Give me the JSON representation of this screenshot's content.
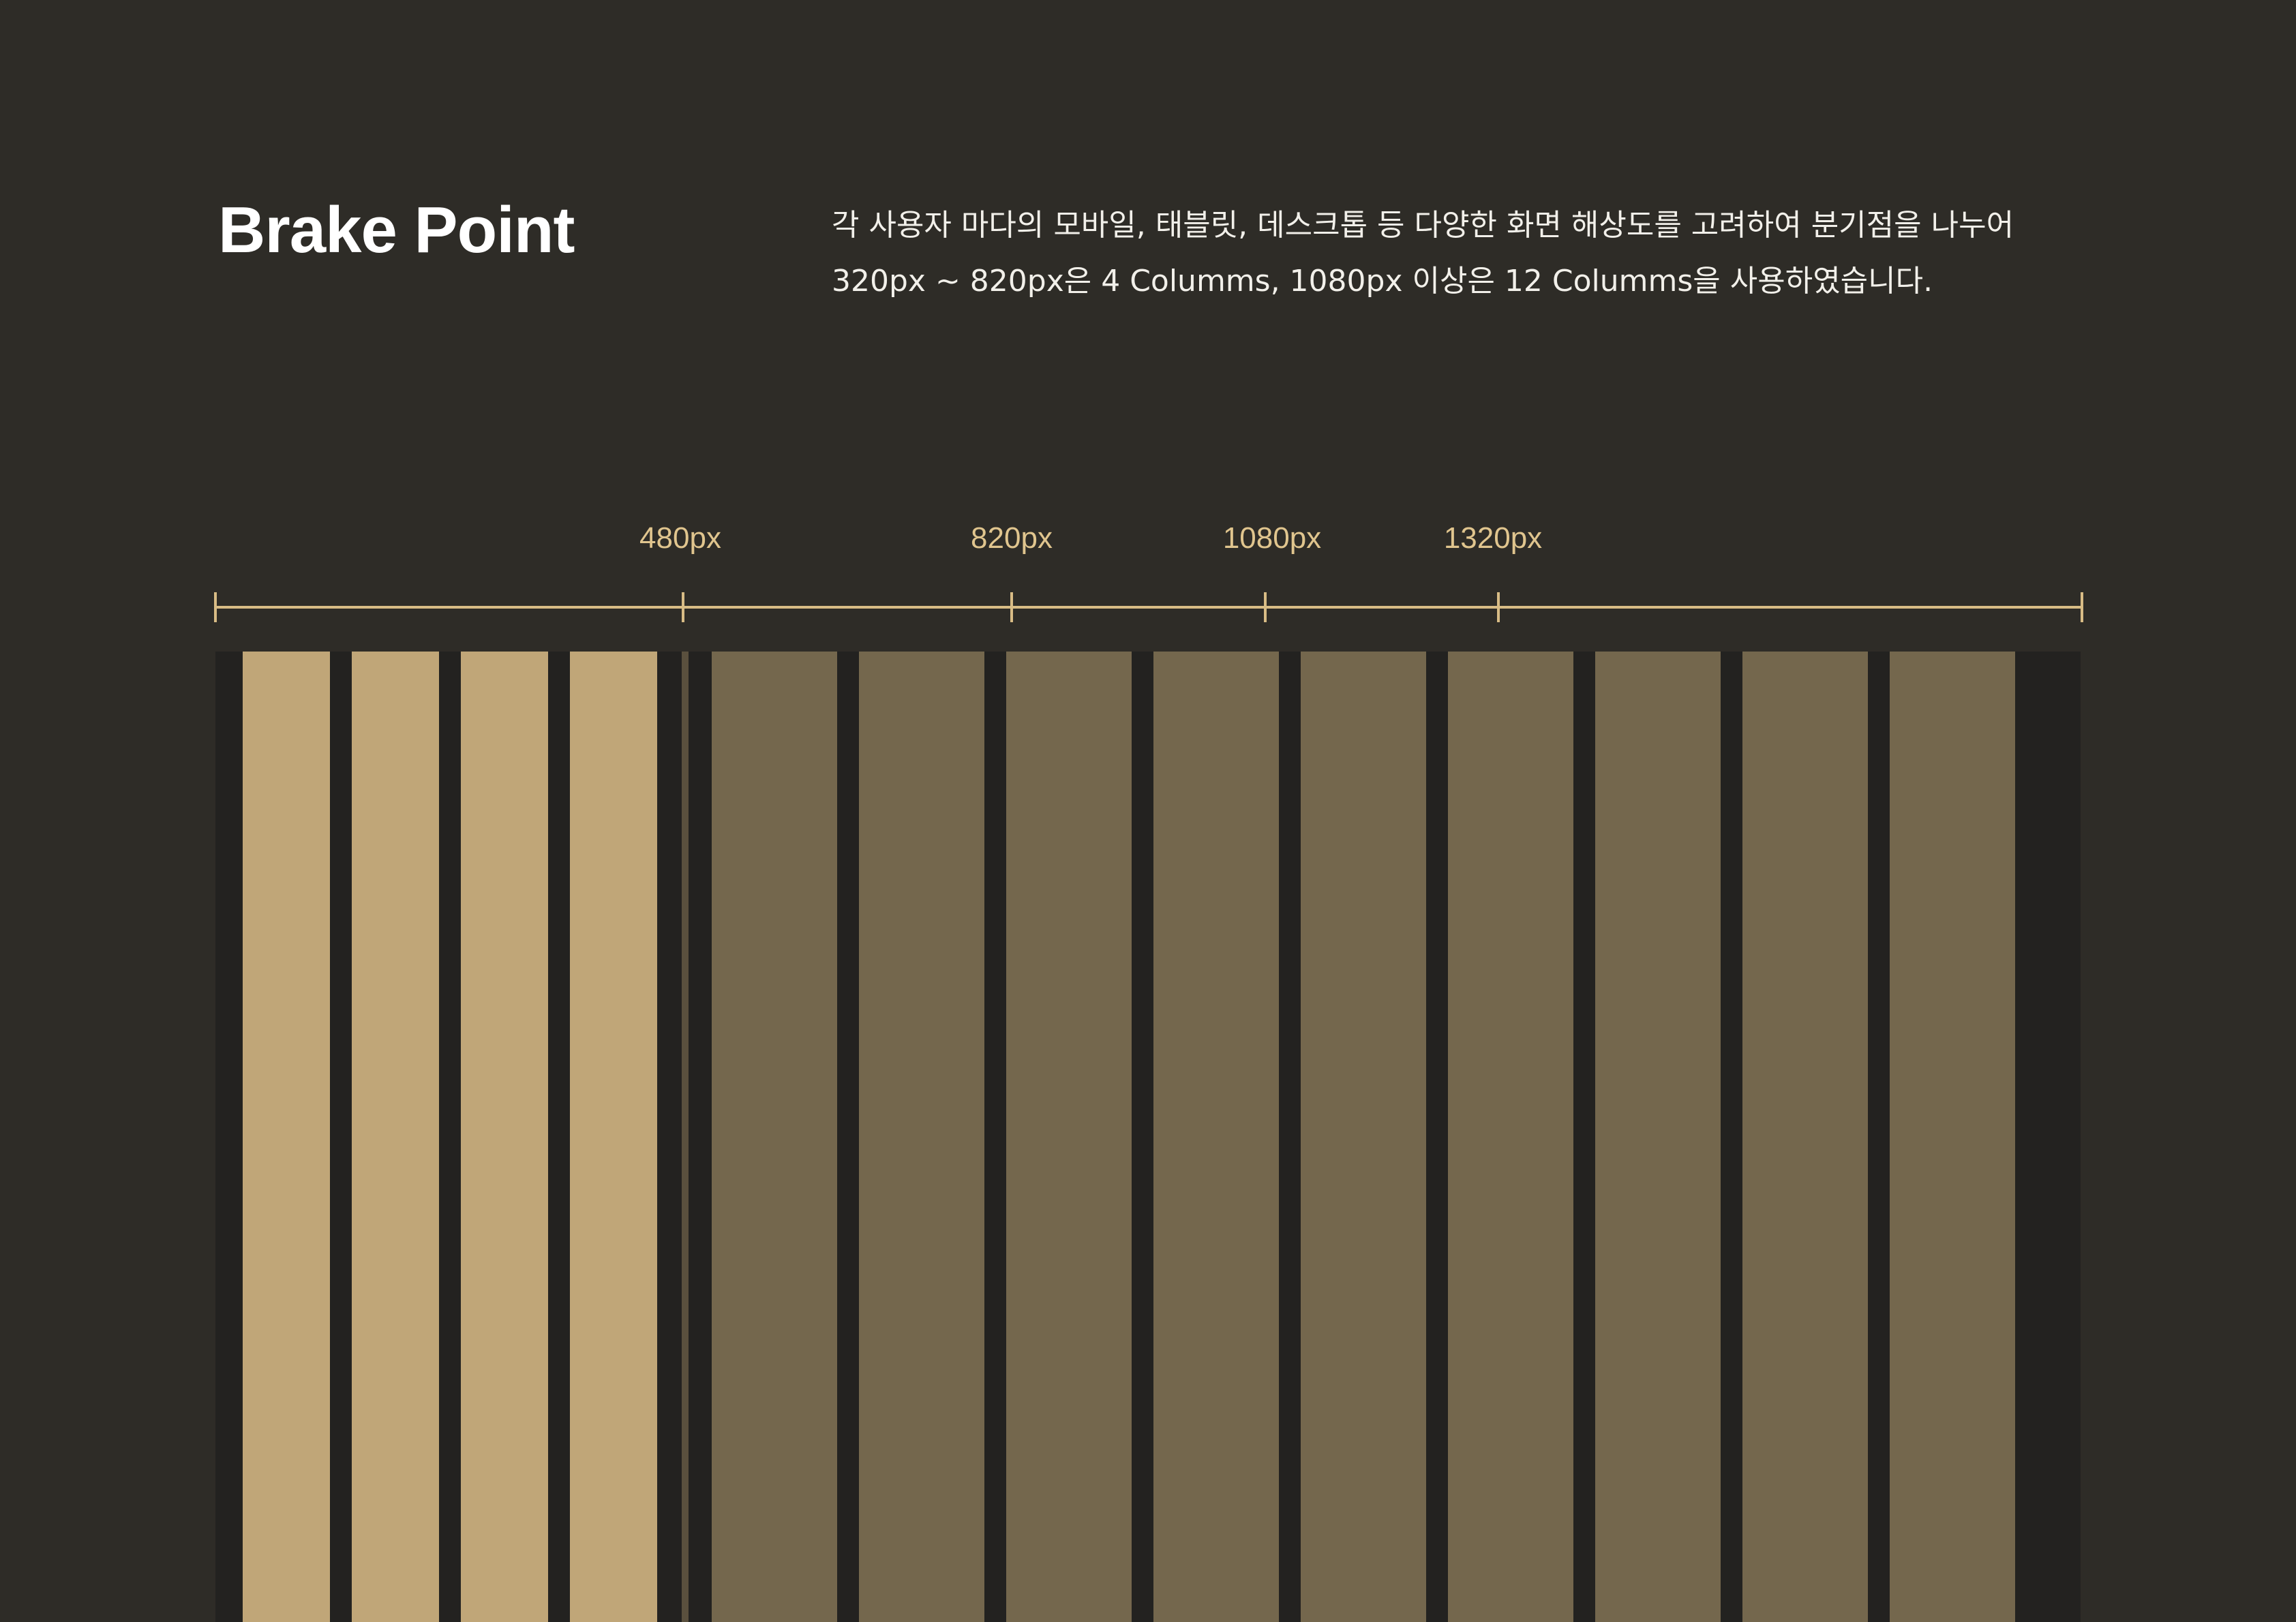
{
  "header": {
    "title": "Brake Point",
    "description": [
      "각 사용자 마다의 모바일, 태블릿, 데스크톱 등 다양한 화면 해상도를 고려하여 분기점을 나누어",
      "320px ~ 820px은 4 Columms, 1080px 이상은 12 Columms을 사용하였습니다."
    ]
  },
  "breakpoints": [
    {
      "label": "480px"
    },
    {
      "label": "820px"
    },
    {
      "label": "1080px"
    },
    {
      "label": "1320px"
    }
  ],
  "grid": {
    "mobile_columns": 4,
    "desktop_columns": 9
  },
  "colors": {
    "background": "#2e2c27",
    "grid_background": "#232220",
    "accent": "#e0c58e",
    "mobile_column": "#c0a678",
    "desktop_column": "#74674d"
  }
}
